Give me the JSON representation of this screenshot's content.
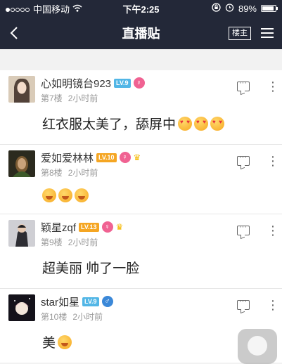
{
  "status_bar": {
    "carrier": "中国移动",
    "time": "下午2:25",
    "battery": "89%",
    "battery_level": 0.89,
    "signal_icon": "signal-dots-icon",
    "wifi_icon": "wifi-icon",
    "alarm_icon": "alarm-icon",
    "lock_icon": "rotation-lock-icon"
  },
  "nav": {
    "title": "直播贴",
    "louzhu_label": "楼主",
    "back_icon": "back-chevron-icon",
    "menu_icon": "hamburger-menu-icon"
  },
  "posts": [
    {
      "username": "心如明镜台923",
      "level": "LV.9",
      "level_color": "#52b6e6",
      "gender": "♀",
      "floor": "第7楼",
      "time": "2小时前",
      "text": "红衣服太美了，舔屏中",
      "emojis": [
        "heart-eyes",
        "heart-eyes",
        "heart-eyes"
      ]
    },
    {
      "username": "爱如爱林林",
      "level": "LV.10",
      "level_color": "#f5a623",
      "gender": "♀",
      "crown": "♛",
      "floor": "第8楼",
      "time": "2小时前",
      "text": "",
      "emojis": [
        "cheer",
        "cheer",
        "cheer"
      ]
    },
    {
      "username": "颖星zqf",
      "level": "LV.13",
      "level_color": "#f5a623",
      "gender": "♀",
      "crown": "♛",
      "floor": "第9楼",
      "time": "2小时前",
      "text": "超美丽 帅了一脸",
      "emojis": []
    },
    {
      "username": "star如星",
      "level": "LV.9",
      "level_color": "#52b6e6",
      "gender": "♂",
      "floor": "第10楼",
      "time": "2小时前",
      "text": "美",
      "emojis": [
        "smirk"
      ]
    }
  ]
}
